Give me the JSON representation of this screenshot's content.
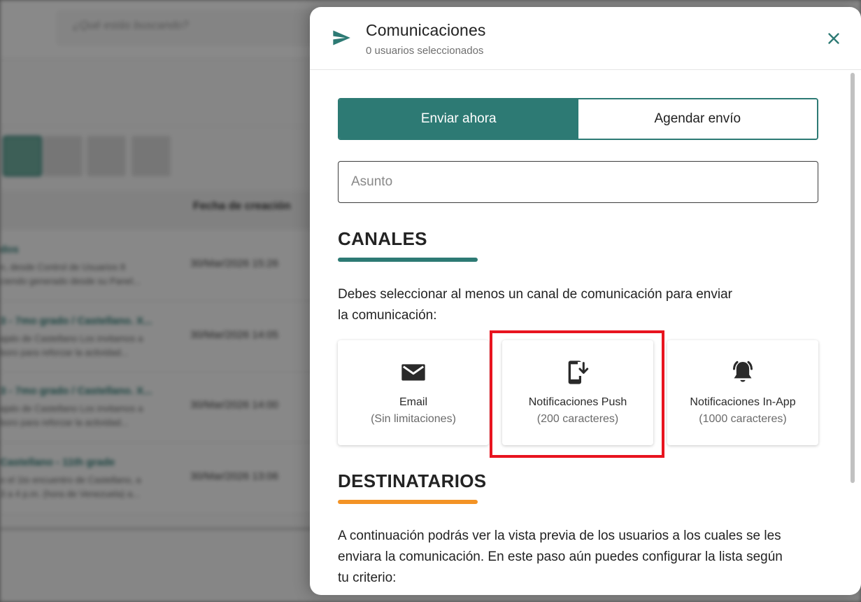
{
  "background": {
    "search_placeholder": "¿Qué estás buscando?",
    "column_header": "Fecha de creación",
    "rows": [
      {
        "title": "dos",
        "line1": "n, desde Control de Usuarios 8",
        "line2": "ciendo generado desde su Panel...",
        "date": "30/Mar/2026 15:26"
      },
      {
        "title": "3 - 7mo grado / Castellano. X...",
        "line1": "ajalo de Castellano Los invitamos a",
        "line2": "boro para reforzar la actividad...",
        "date": "30/Mar/2026 14:05"
      },
      {
        "title": "3 - 7mo grado / Castellano. X...",
        "line1": "ajalo de Castellano Los invitamos a",
        "line2": "boro para reforzar la actividad...",
        "date": "30/Mar/2026 14:00"
      },
      {
        "title": "Castellano - 11th grade",
        "line1": "o el 1to encuentro de Castellano, a",
        "line2": "3 a 4 p.m. (hora de Venezuela) a...",
        "date": "30/Mar/2026 13:06"
      }
    ]
  },
  "drawer": {
    "title": "Comunicaciones",
    "subtitle": "0 usuarios seleccionados",
    "tabs": {
      "now": "Enviar ahora",
      "schedule": "Agendar envío"
    },
    "subject_placeholder": "Asunto",
    "channels_section": {
      "title": "CANALES",
      "helper_line1": "Debes seleccionar al menos un canal de comunicación para enviar",
      "helper_line2": "la comunicación:",
      "items": [
        {
          "name": "Email",
          "limit": "(Sin limitaciones)",
          "icon": "mail-icon"
        },
        {
          "name": "Notificaciones Push",
          "limit": "(200 caracteres)",
          "icon": "phone-download-icon"
        },
        {
          "name": "Notificaciones In-App",
          "limit": "(1000 caracteres)",
          "icon": "bell-ring-icon"
        }
      ]
    },
    "recipients_section": {
      "title": "DESTINATARIOS",
      "helper_line1": "A continuación podrás ver la vista previa de los usuarios a los cuales se les",
      "helper_line2": "enviara la comunicación. En este paso aún puedes configurar la lista según",
      "helper_line3": "tu criterio:"
    }
  },
  "colors": {
    "primary": "#2d7a74",
    "accent_orange": "#f39325",
    "highlight_red": "#e8141f"
  }
}
